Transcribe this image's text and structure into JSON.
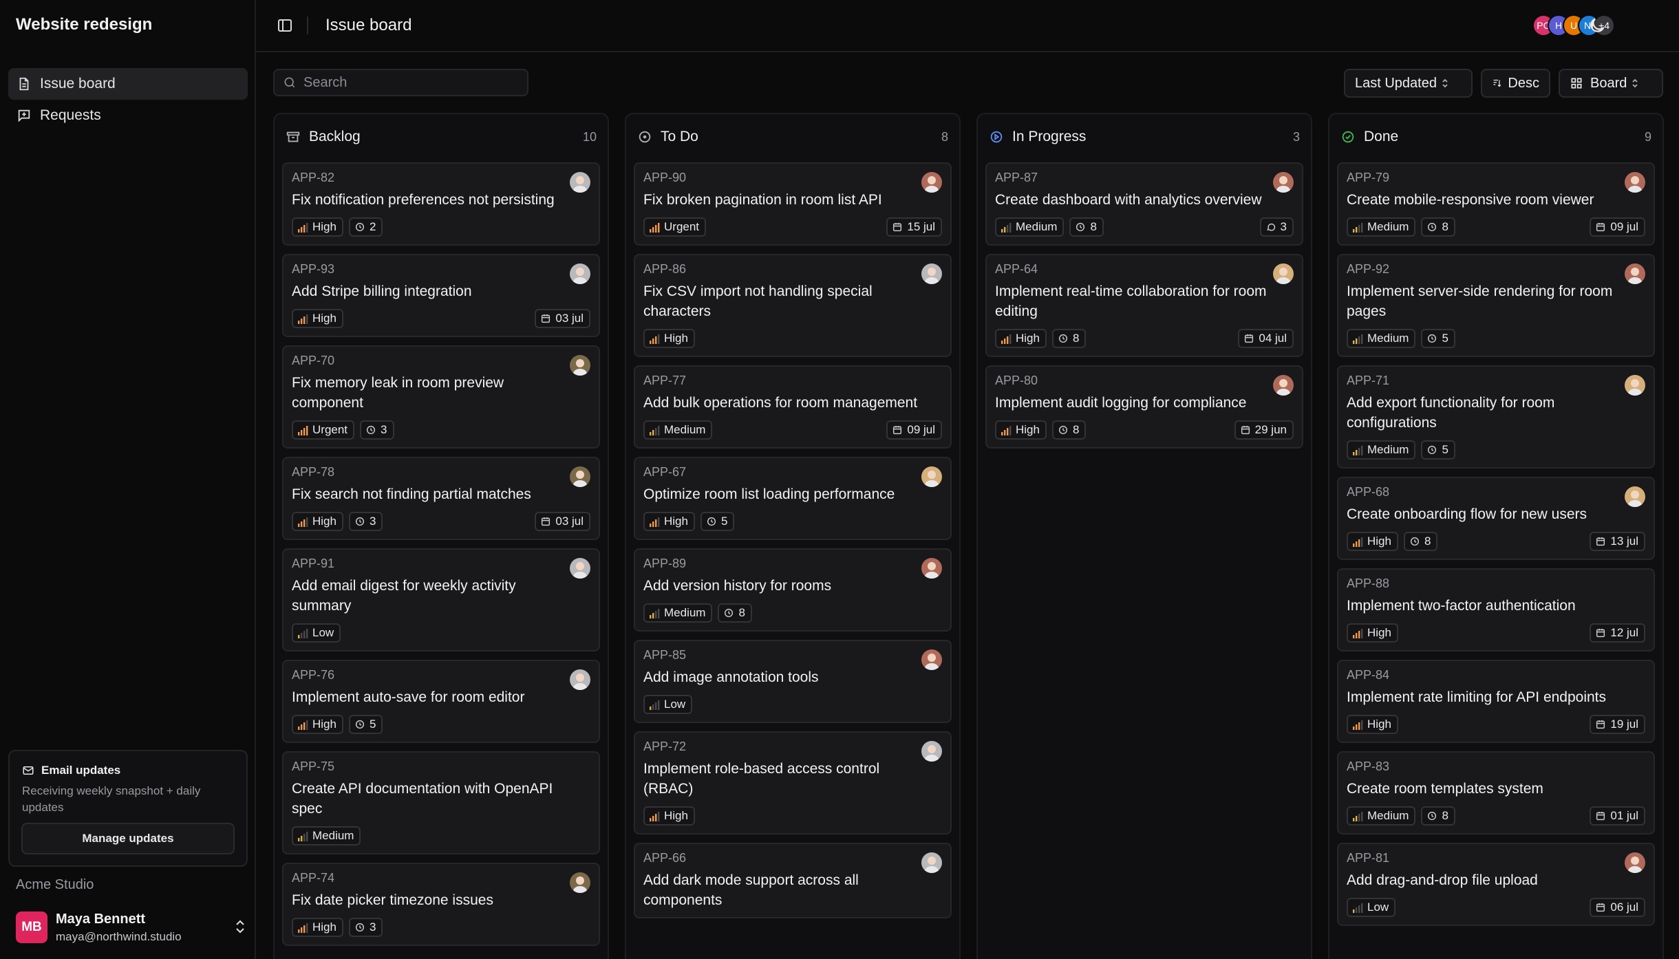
{
  "sidebar": {
    "workspace": "Website redesign",
    "nav": [
      {
        "label": "Issue board",
        "icon": "document-icon"
      },
      {
        "label": "Requests",
        "icon": "message-plus-icon"
      }
    ],
    "email_card": {
      "title": "Email updates",
      "description": "Receiving weekly snapshot + daily updates",
      "button": "Manage updates"
    },
    "org": "Acme Studio",
    "user": {
      "initials": "MB",
      "name": "Maya Bennett",
      "email": "maya@northwind.studio"
    }
  },
  "topbar": {
    "title": "Issue board",
    "avatars": [
      {
        "label": "PC",
        "color": "#d6336c"
      },
      {
        "label": "H",
        "color": "#5b5bd6"
      },
      {
        "label": "U",
        "color": "#e67700"
      },
      {
        "label": "NI",
        "color": "#1c7ed6"
      },
      {
        "label": "+4",
        "color": "#3a3a3e"
      }
    ]
  },
  "toolbar": {
    "search_placeholder": "Search",
    "sort": "Last Updated",
    "order": "Desc",
    "view": "Board"
  },
  "columns": [
    {
      "title": "Backlog",
      "count": "10",
      "icon": "archive-icon",
      "cards": [
        {
          "id": "APP-82",
          "title": "Fix notification preferences not persisting",
          "priority": "High",
          "estimate": "2",
          "date": "",
          "comments": "",
          "avatar": "#b9b9bd"
        },
        {
          "id": "APP-93",
          "title": "Add Stripe billing integration",
          "priority": "High",
          "estimate": "",
          "date": "03 jul",
          "comments": "",
          "avatar": "#b9b9bd"
        },
        {
          "id": "APP-70",
          "title": "Fix memory leak in room preview component",
          "priority": "Urgent",
          "estimate": "3",
          "date": "",
          "comments": "",
          "avatar": "#7a6a4a"
        },
        {
          "id": "APP-78",
          "title": "Fix search not finding partial matches",
          "priority": "High",
          "estimate": "3",
          "date": "03 jul",
          "comments": "",
          "avatar": "#7a6a4a"
        },
        {
          "id": "APP-91",
          "title": "Add email digest for weekly activity summary",
          "priority": "Low",
          "estimate": "",
          "date": "",
          "comments": "",
          "avatar": "#b9b9bd"
        },
        {
          "id": "APP-76",
          "title": "Implement auto-save for room editor",
          "priority": "High",
          "estimate": "5",
          "date": "",
          "comments": "",
          "avatar": "#b9b9bd"
        },
        {
          "id": "APP-75",
          "title": "Create API documentation with OpenAPI spec",
          "priority": "Medium",
          "estimate": "",
          "date": "",
          "comments": "",
          "avatar": ""
        },
        {
          "id": "APP-74",
          "title": "Fix date picker timezone issues",
          "priority": "High",
          "estimate": "3",
          "date": "",
          "comments": "",
          "avatar": "#7a6a4a"
        }
      ]
    },
    {
      "title": "To Do",
      "count": "8",
      "icon": "circle-dot-icon",
      "cards": [
        {
          "id": "APP-90",
          "title": "Fix broken pagination in room list API",
          "priority": "Urgent",
          "estimate": "",
          "date": "15 jul",
          "comments": "",
          "avatar": "#b06a5a"
        },
        {
          "id": "APP-86",
          "title": "Fix CSV import not handling special characters",
          "priority": "High",
          "estimate": "",
          "date": "",
          "comments": "",
          "avatar": "#b9b9bd"
        },
        {
          "id": "APP-77",
          "title": "Add bulk operations for room management",
          "priority": "Medium",
          "estimate": "",
          "date": "09 jul",
          "comments": "",
          "avatar": ""
        },
        {
          "id": "APP-67",
          "title": "Optimize room list loading performance",
          "priority": "High",
          "estimate": "5",
          "date": "",
          "comments": "",
          "avatar": "#d6b07a"
        },
        {
          "id": "APP-89",
          "title": "Add version history for rooms",
          "priority": "Medium",
          "estimate": "8",
          "date": "",
          "comments": "",
          "avatar": "#b06a5a"
        },
        {
          "id": "APP-85",
          "title": "Add image annotation tools",
          "priority": "Low",
          "estimate": "",
          "date": "",
          "comments": "",
          "avatar": "#b06a5a"
        },
        {
          "id": "APP-72",
          "title": "Implement role-based access control (RBAC)",
          "priority": "High",
          "estimate": "",
          "date": "",
          "comments": "",
          "avatar": "#b9b9bd"
        },
        {
          "id": "APP-66",
          "title": "Add dark mode support across all components",
          "priority": "",
          "estimate": "",
          "date": "",
          "comments": "",
          "avatar": "#b9b9bd"
        }
      ]
    },
    {
      "title": "In Progress",
      "count": "3",
      "icon": "play-circle-icon",
      "cards": [
        {
          "id": "APP-87",
          "title": "Create dashboard with analytics overview",
          "priority": "Medium",
          "estimate": "8",
          "date": "",
          "comments": "3",
          "avatar": "#b06a5a"
        },
        {
          "id": "APP-64",
          "title": "Implement real-time collaboration for room editing",
          "priority": "High",
          "estimate": "8",
          "date": "04 jul",
          "comments": "",
          "avatar": "#d6b07a"
        },
        {
          "id": "APP-80",
          "title": "Implement audit logging for compliance",
          "priority": "High",
          "estimate": "8",
          "date": "29 jun",
          "comments": "",
          "avatar": "#b06a5a"
        }
      ]
    },
    {
      "title": "Done",
      "count": "9",
      "icon": "check-circle-icon",
      "cards": [
        {
          "id": "APP-79",
          "title": "Create mobile-responsive room viewer",
          "priority": "Medium",
          "estimate": "8",
          "date": "09 jul",
          "comments": "",
          "avatar": "#b06a5a"
        },
        {
          "id": "APP-92",
          "title": "Implement server-side rendering for room pages",
          "priority": "Medium",
          "estimate": "5",
          "date": "",
          "comments": "",
          "avatar": "#b06a5a"
        },
        {
          "id": "APP-71",
          "title": "Add export functionality for room configurations",
          "priority": "Medium",
          "estimate": "5",
          "date": "",
          "comments": "",
          "avatar": "#d6b07a"
        },
        {
          "id": "APP-68",
          "title": "Create onboarding flow for new users",
          "priority": "High",
          "estimate": "8",
          "date": "13 jul",
          "comments": "",
          "avatar": "#d6b07a"
        },
        {
          "id": "APP-88",
          "title": "Implement two-factor authentication",
          "priority": "High",
          "estimate": "",
          "date": "12 jul",
          "comments": "",
          "avatar": ""
        },
        {
          "id": "APP-84",
          "title": "Implement rate limiting for API endpoints",
          "priority": "High",
          "estimate": "",
          "date": "19 jul",
          "comments": "",
          "avatar": ""
        },
        {
          "id": "APP-83",
          "title": "Create room templates system",
          "priority": "Medium",
          "estimate": "8",
          "date": "01 jul",
          "comments": "",
          "avatar": ""
        },
        {
          "id": "APP-81",
          "title": "Add drag-and-drop file upload",
          "priority": "Low",
          "estimate": "",
          "date": "06 jul",
          "comments": "",
          "avatar": "#b06a5a"
        }
      ]
    }
  ]
}
